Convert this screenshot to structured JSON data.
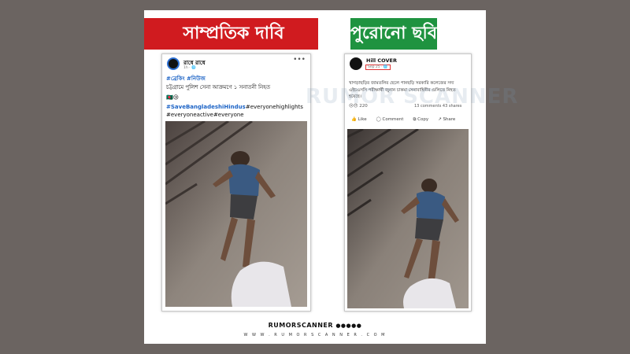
{
  "banners": {
    "left_label": "সাম্প্রতিক দাবি",
    "right_label": "পুরোনো ছবি"
  },
  "left_post": {
    "author": "রাধে রাধে",
    "time": "1h · 🌐",
    "more": "•••",
    "tag_line": "#ব্রেকিং #নিউজ",
    "body": "চট্টগ্রামে পুলিশ সেনা আক্রমণে ১ সনাতনী নিহত",
    "emoji": "🇧🇩😢",
    "hashtag_main": "#SaveBangladeshiHindus",
    "hashtag_rest": "#everyonehighlights",
    "hashtag_line2": "#everyoneactive#everyone"
  },
  "right_post": {
    "author": "Hill COVER",
    "date": "Sep 25 · 🌐",
    "body": "খাগড়াছড়ির জামতলির ছেলে পানছড়ি সরকারি কলেজের সদ্য এইচএসসি পরীক্ষার্থী জুনান চাকমা সেনাবাহিনীর গুলিতে নিহত হয়েছে।",
    "reactions": "220",
    "comments_shares": "13 comments  43 shares",
    "actions": [
      "Like",
      "Comment",
      "Copy",
      "Share"
    ]
  },
  "footer": {
    "logo": "RUMORSCANNER",
    "url": "W W W . R U M O R S C A N N E R . C O M"
  },
  "watermark": "RUMOR SCANNER",
  "colors": {
    "claim_red": "#d01b1f",
    "old_green": "#1f9340",
    "hashtag_blue": "#1d64c6",
    "background": "#6b6461"
  }
}
